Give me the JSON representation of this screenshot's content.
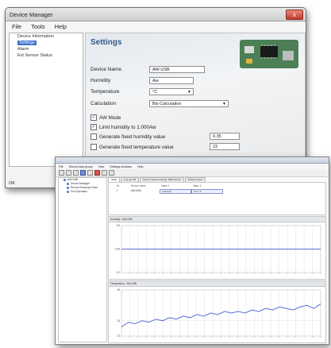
{
  "back_window": {
    "title": "Device Manager",
    "close_glyph": "x",
    "menu": [
      "File",
      "Tools",
      "Help"
    ],
    "tree": [
      {
        "label": "Device Information"
      },
      {
        "label": "Settings",
        "selected": true
      },
      {
        "label": "Alarm"
      },
      {
        "label": "Ext Sensor Status"
      }
    ],
    "panel_title": "Settings",
    "fields": {
      "device_name": {
        "label": "Device Name",
        "value": "AW-USB"
      },
      "humidity": {
        "label": "Humidity",
        "value": "Aw"
      },
      "temperature": {
        "label": "Temperature",
        "value": "°C"
      },
      "calculation": {
        "label": "Calculation",
        "value": "Bis Calculation"
      }
    },
    "checks": [
      {
        "label": "AW Mode",
        "checked": true
      },
      {
        "label": "Limit humidity to 1.000Aw",
        "checked": true
      },
      {
        "label": "Generate fixed humidity value",
        "checked": false,
        "value": "0.35"
      },
      {
        "label": "Generate fixed temperature value",
        "checked": false,
        "value": "23"
      }
    ],
    "status": "OK",
    "icons": [
      "circuit-board-image",
      "chevron-down-icon",
      "checkbox-icon"
    ]
  },
  "front_window": {
    "menu": [
      "File",
      "Record data group",
      "View",
      "Settings windows",
      "Help"
    ],
    "tree": [
      {
        "label": "AW-USB",
        "color": "#4a74c9"
      },
      {
        "label": "Device Manager",
        "color": "#4a74c9"
      },
      {
        "label": "Record Summary Data",
        "color": "#4a74c9"
      },
      {
        "label": "Plot Operation",
        "color": "#4a74c9"
      }
    ],
    "tabs": [
      "Table",
      "Log pan 05",
      "Device values settings: DBP Device",
      "Others device"
    ],
    "table": {
      "headers": [
        "Nr",
        "Device name",
        "Value 1",
        "Value 2"
      ],
      "row": [
        "1",
        "AW-USB",
        "0.350 Aw",
        "23.0 °C"
      ]
    },
    "chart1_title": "Humidity - AW-USB",
    "chart2_title": "Temperature - AW-USB",
    "accent": "#5b6fd6"
  },
  "chart_data": [
    {
      "type": "line",
      "title": "Humidity - AW-USB",
      "series": [
        {
          "values": [
            0.35,
            0.35,
            0.35,
            0.35,
            0.35,
            0.35,
            0.35,
            0.35,
            0.35,
            0.35,
            0.35,
            0.35,
            0.35,
            0.35,
            0.35,
            0.35,
            0.35,
            0.35,
            0.35,
            0.35,
            0.35,
            0.35,
            0.35,
            0.35,
            0.35,
            0.35,
            0.35,
            0.35,
            0.35,
            0.35
          ]
        }
      ],
      "ylim": [
        0.2,
        0.5
      ],
      "yticks": [
        "0.5",
        "0.35",
        "0.2"
      ],
      "grid": true
    },
    {
      "type": "line",
      "title": "Temperature - AW-USB",
      "series": [
        {
          "values": [
            22.6,
            22.9,
            22.8,
            23.0,
            22.9,
            23.1,
            23.0,
            23.2,
            23.1,
            23.3,
            23.2,
            23.4,
            23.3,
            23.5,
            23.4,
            23.6,
            23.5,
            23.6,
            23.5,
            23.7,
            23.6,
            23.8,
            23.7,
            23.9,
            23.8,
            23.7,
            23.9,
            24.0,
            23.8,
            24.1
          ]
        }
      ],
      "ylim": [
        22,
        25
      ],
      "yticks": [
        "25",
        "23",
        "22"
      ],
      "grid": true
    }
  ]
}
